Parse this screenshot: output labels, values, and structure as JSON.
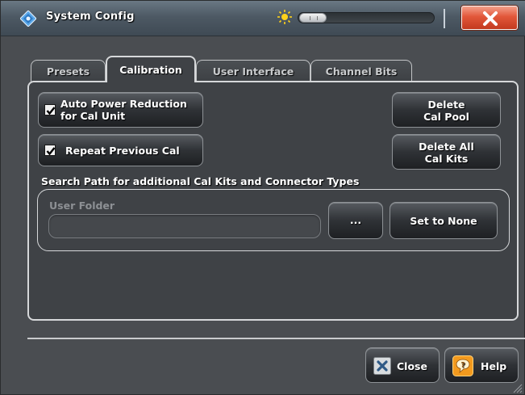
{
  "window": {
    "title": "System Config",
    "icons": {
      "app": "settings-diamond-icon",
      "brightness": "sun-icon",
      "close": "close-icon"
    },
    "brightness_slider": {
      "level": 0.1
    }
  },
  "tabs": [
    {
      "label": "Presets",
      "active": false
    },
    {
      "label": "Calibration",
      "active": true
    },
    {
      "label": "User Interface",
      "active": false
    },
    {
      "label": "Channel Bits",
      "active": false
    }
  ],
  "calibration": {
    "auto_power_reduction": {
      "line1": "Auto Power Reduction",
      "line2": "for Cal Unit",
      "checked": true
    },
    "repeat_previous_cal": {
      "label": "Repeat Previous Cal",
      "checked": true
    },
    "delete_cal_pool": {
      "line1": "Delete",
      "line2": "Cal Pool"
    },
    "delete_all_cal_kits": {
      "line1": "Delete All",
      "line2": "Cal Kits"
    },
    "search_path": {
      "group_label": "Search Path for additional Cal Kits and Connector Types",
      "folder_label": "User Folder",
      "folder_value": "",
      "browse_label": "...",
      "set_none_label": "Set to None"
    }
  },
  "footer": {
    "close_label": "Close",
    "help_label": "Help"
  },
  "colors": {
    "close_accent": "#e2573a",
    "help_accent": "#f39a1e",
    "panel_bg": "#3f4246"
  }
}
